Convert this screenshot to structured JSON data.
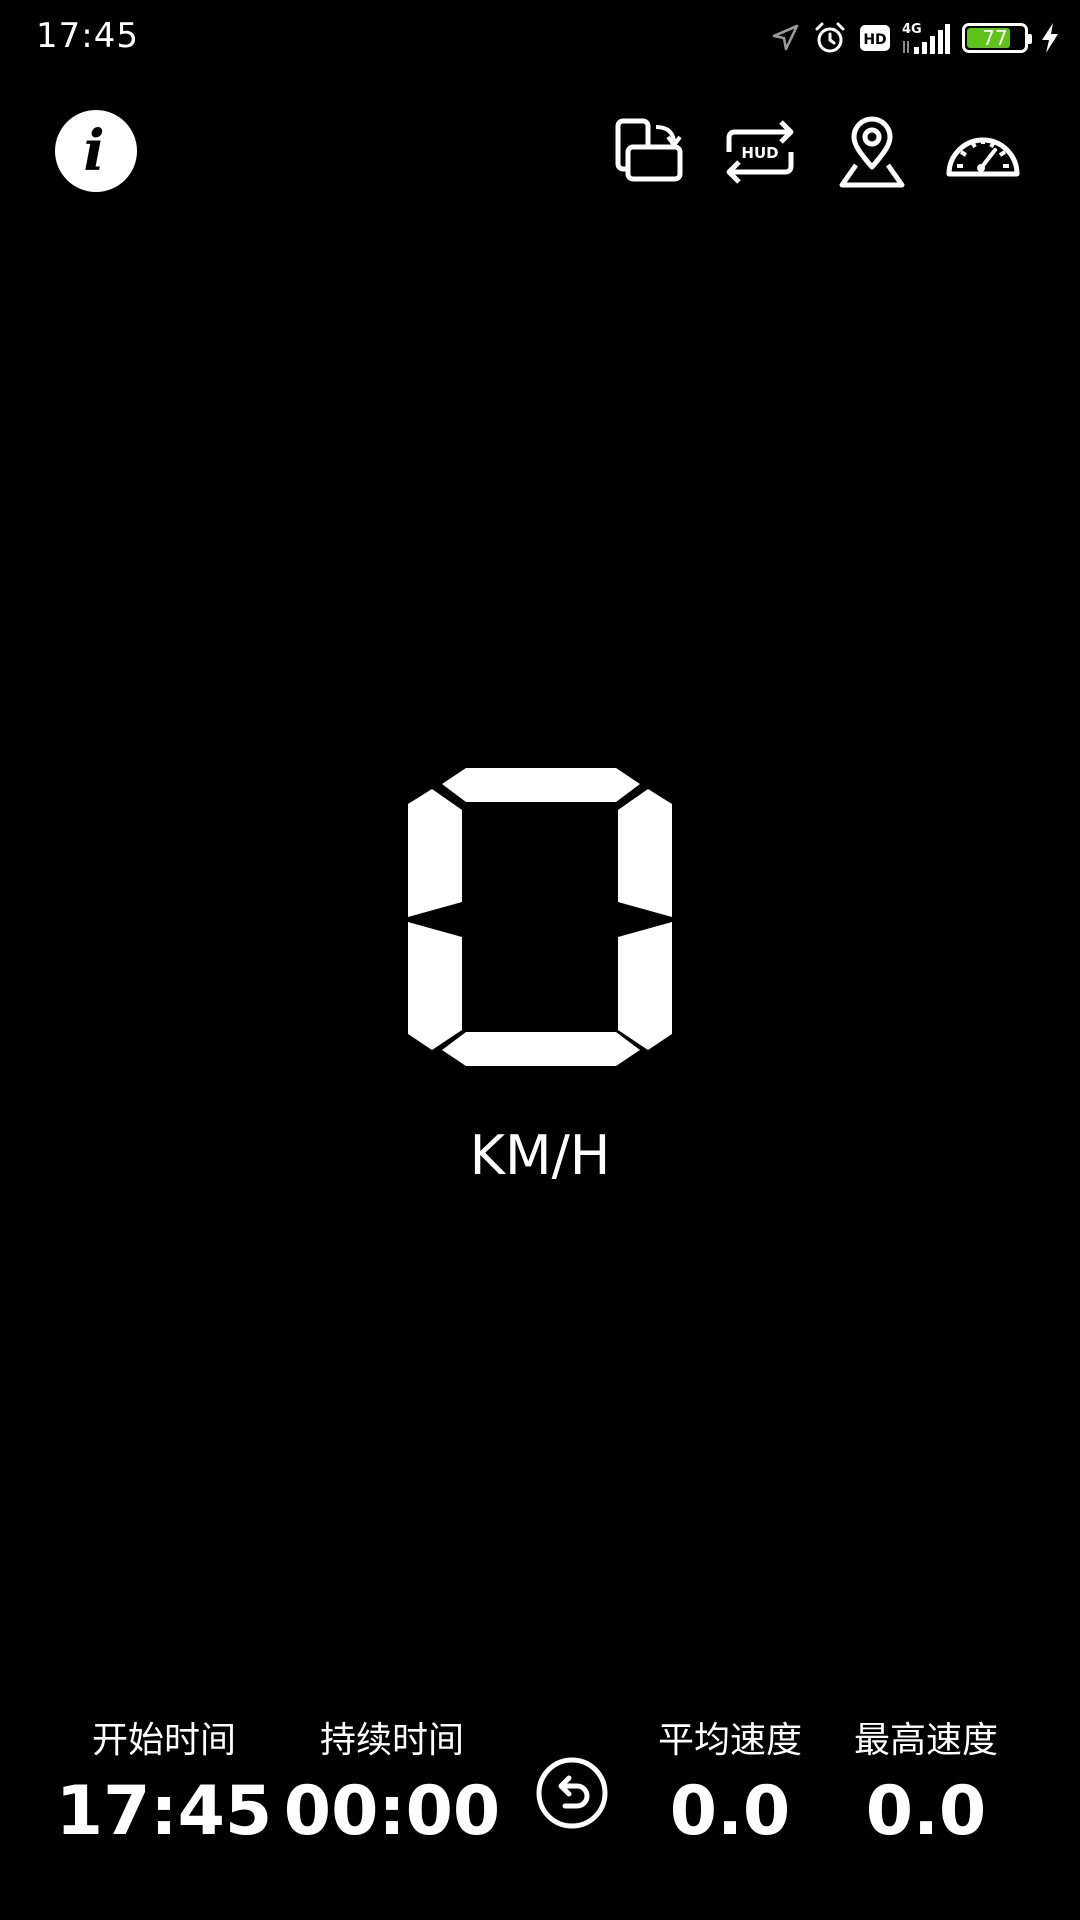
{
  "status_bar": {
    "time": "17:45",
    "battery_level": "77",
    "battery_fraction": 0.77,
    "network_label": "4G",
    "hd_label": "HD",
    "icons": [
      "location-arrow-icon",
      "alarm-icon",
      "hd-icon",
      "signal-icon",
      "battery-icon",
      "charging-icon"
    ]
  },
  "toolbar": {
    "info_label": "i",
    "hud_label": "HUD",
    "buttons": [
      "rotate-screen-icon",
      "hud-mirror-icon",
      "map-pin-icon",
      "speedometer-icon"
    ]
  },
  "speed": {
    "value": "0",
    "unit": "KM/H"
  },
  "stats": {
    "start_time": {
      "label": "开始时间",
      "value": "17:45"
    },
    "duration": {
      "label": "持续时间",
      "value": "00:00"
    },
    "avg_speed": {
      "label": "平均速度",
      "value": "0.0"
    },
    "max_speed": {
      "label": "最高速度",
      "value": "0.0"
    }
  },
  "colors": {
    "background": "#000000",
    "foreground": "#ffffff",
    "battery_green": "#5fc31c",
    "status_icon_gray": "#9a9a9a"
  }
}
